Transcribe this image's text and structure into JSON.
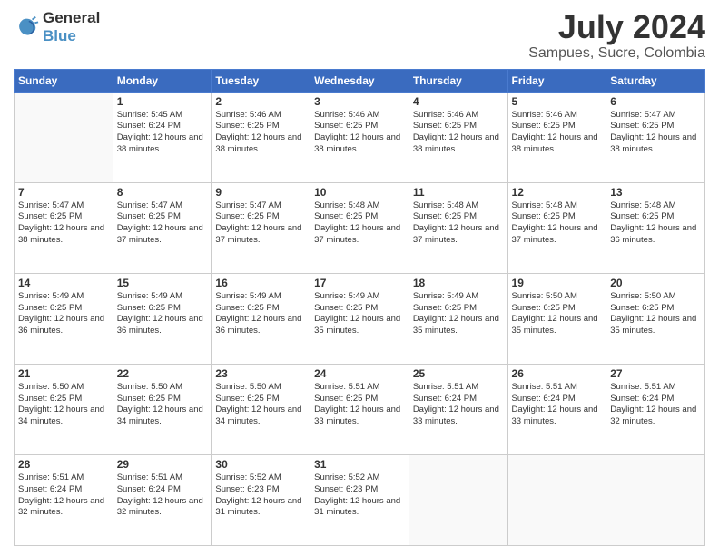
{
  "header": {
    "logo_line1": "General",
    "logo_line2": "Blue",
    "month_year": "July 2024",
    "location": "Sampues, Sucre, Colombia"
  },
  "days_of_week": [
    "Sunday",
    "Monday",
    "Tuesday",
    "Wednesday",
    "Thursday",
    "Friday",
    "Saturday"
  ],
  "weeks": [
    [
      {
        "day": "",
        "info": ""
      },
      {
        "day": "1",
        "info": "Sunrise: 5:45 AM\nSunset: 6:24 PM\nDaylight: 12 hours\nand 38 minutes."
      },
      {
        "day": "2",
        "info": "Sunrise: 5:46 AM\nSunset: 6:25 PM\nDaylight: 12 hours\nand 38 minutes."
      },
      {
        "day": "3",
        "info": "Sunrise: 5:46 AM\nSunset: 6:25 PM\nDaylight: 12 hours\nand 38 minutes."
      },
      {
        "day": "4",
        "info": "Sunrise: 5:46 AM\nSunset: 6:25 PM\nDaylight: 12 hours\nand 38 minutes."
      },
      {
        "day": "5",
        "info": "Sunrise: 5:46 AM\nSunset: 6:25 PM\nDaylight: 12 hours\nand 38 minutes."
      },
      {
        "day": "6",
        "info": "Sunrise: 5:47 AM\nSunset: 6:25 PM\nDaylight: 12 hours\nand 38 minutes."
      }
    ],
    [
      {
        "day": "7",
        "info": "Sunrise: 5:47 AM\nSunset: 6:25 PM\nDaylight: 12 hours\nand 38 minutes."
      },
      {
        "day": "8",
        "info": "Sunrise: 5:47 AM\nSunset: 6:25 PM\nDaylight: 12 hours\nand 37 minutes."
      },
      {
        "day": "9",
        "info": "Sunrise: 5:47 AM\nSunset: 6:25 PM\nDaylight: 12 hours\nand 37 minutes."
      },
      {
        "day": "10",
        "info": "Sunrise: 5:48 AM\nSunset: 6:25 PM\nDaylight: 12 hours\nand 37 minutes."
      },
      {
        "day": "11",
        "info": "Sunrise: 5:48 AM\nSunset: 6:25 PM\nDaylight: 12 hours\nand 37 minutes."
      },
      {
        "day": "12",
        "info": "Sunrise: 5:48 AM\nSunset: 6:25 PM\nDaylight: 12 hours\nand 37 minutes."
      },
      {
        "day": "13",
        "info": "Sunrise: 5:48 AM\nSunset: 6:25 PM\nDaylight: 12 hours\nand 36 minutes."
      }
    ],
    [
      {
        "day": "14",
        "info": "Sunrise: 5:49 AM\nSunset: 6:25 PM\nDaylight: 12 hours\nand 36 minutes."
      },
      {
        "day": "15",
        "info": "Sunrise: 5:49 AM\nSunset: 6:25 PM\nDaylight: 12 hours\nand 36 minutes."
      },
      {
        "day": "16",
        "info": "Sunrise: 5:49 AM\nSunset: 6:25 PM\nDaylight: 12 hours\nand 36 minutes."
      },
      {
        "day": "17",
        "info": "Sunrise: 5:49 AM\nSunset: 6:25 PM\nDaylight: 12 hours\nand 35 minutes."
      },
      {
        "day": "18",
        "info": "Sunrise: 5:49 AM\nSunset: 6:25 PM\nDaylight: 12 hours\nand 35 minutes."
      },
      {
        "day": "19",
        "info": "Sunrise: 5:50 AM\nSunset: 6:25 PM\nDaylight: 12 hours\nand 35 minutes."
      },
      {
        "day": "20",
        "info": "Sunrise: 5:50 AM\nSunset: 6:25 PM\nDaylight: 12 hours\nand 35 minutes."
      }
    ],
    [
      {
        "day": "21",
        "info": "Sunrise: 5:50 AM\nSunset: 6:25 PM\nDaylight: 12 hours\nand 34 minutes."
      },
      {
        "day": "22",
        "info": "Sunrise: 5:50 AM\nSunset: 6:25 PM\nDaylight: 12 hours\nand 34 minutes."
      },
      {
        "day": "23",
        "info": "Sunrise: 5:50 AM\nSunset: 6:25 PM\nDaylight: 12 hours\nand 34 minutes."
      },
      {
        "day": "24",
        "info": "Sunrise: 5:51 AM\nSunset: 6:25 PM\nDaylight: 12 hours\nand 33 minutes."
      },
      {
        "day": "25",
        "info": "Sunrise: 5:51 AM\nSunset: 6:24 PM\nDaylight: 12 hours\nand 33 minutes."
      },
      {
        "day": "26",
        "info": "Sunrise: 5:51 AM\nSunset: 6:24 PM\nDaylight: 12 hours\nand 33 minutes."
      },
      {
        "day": "27",
        "info": "Sunrise: 5:51 AM\nSunset: 6:24 PM\nDaylight: 12 hours\nand 32 minutes."
      }
    ],
    [
      {
        "day": "28",
        "info": "Sunrise: 5:51 AM\nSunset: 6:24 PM\nDaylight: 12 hours\nand 32 minutes."
      },
      {
        "day": "29",
        "info": "Sunrise: 5:51 AM\nSunset: 6:24 PM\nDaylight: 12 hours\nand 32 minutes."
      },
      {
        "day": "30",
        "info": "Sunrise: 5:52 AM\nSunset: 6:23 PM\nDaylight: 12 hours\nand 31 minutes."
      },
      {
        "day": "31",
        "info": "Sunrise: 5:52 AM\nSunset: 6:23 PM\nDaylight: 12 hours\nand 31 minutes."
      },
      {
        "day": "",
        "info": ""
      },
      {
        "day": "",
        "info": ""
      },
      {
        "day": "",
        "info": ""
      }
    ]
  ]
}
